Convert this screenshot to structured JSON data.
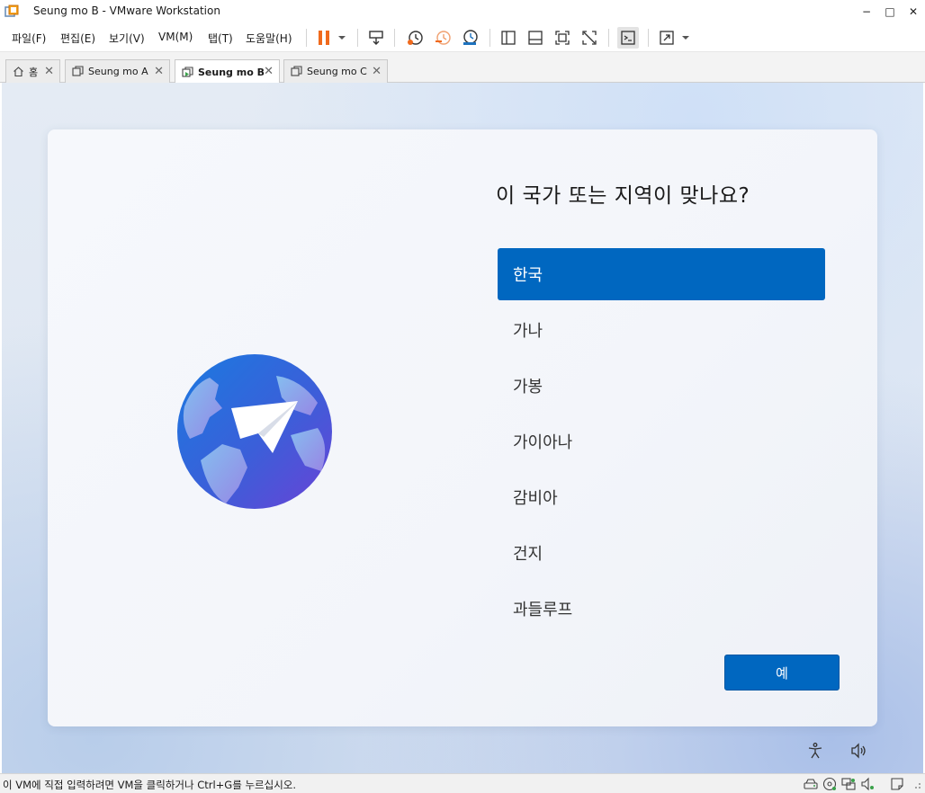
{
  "window": {
    "title": "Seung mo B - VMware Workstation",
    "minimize": "−",
    "maximize": "□",
    "close": "✕"
  },
  "menu": {
    "items": [
      "파일(F)",
      "편집(E)",
      "보기(V)",
      "VM(M)",
      "탭(T)",
      "도움말(H)"
    ]
  },
  "toolbar": {
    "icons": [
      "pause-icon",
      "dropdown-arrow-icon",
      "send-ctrl-alt-del-icon",
      "snapshot-take-icon",
      "snapshot-revert-icon",
      "snapshot-manager-icon",
      "library-view-icon",
      "thumbnail-bar-icon",
      "full-screen-icon",
      "unity-icon",
      "console-view-icon",
      "stretch-icon",
      "dropdown-arrow-icon"
    ]
  },
  "tabs": [
    {
      "label": "홈",
      "icon": "home-icon"
    },
    {
      "label": "Seung mo A",
      "icon": "vm-icon"
    },
    {
      "label": "Seung mo B",
      "icon": "vm-running-icon"
    },
    {
      "label": "Seung mo C",
      "icon": "vm-icon"
    }
  ],
  "tab_close": "✕",
  "oobe": {
    "heading": "이 국가 또는 지역이 맞나요?",
    "countries": [
      "한국",
      "가나",
      "가봉",
      "가이아나",
      "감비아",
      "건지",
      "과들루프"
    ],
    "selected_index": 0,
    "yes_button": "예"
  },
  "status": {
    "text": "이 VM에 직접 입력하려면 VM을 클릭하거나 Ctrl+G를 누르십시오."
  },
  "colors": {
    "accent": "#0067c0",
    "pause": "#f06a1d"
  }
}
